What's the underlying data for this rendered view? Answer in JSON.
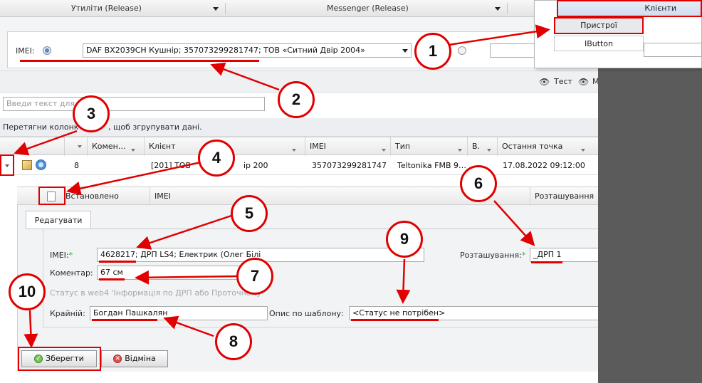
{
  "tabs": {
    "utilities": "Утиліти (Release)",
    "messenger": "Messenger (Release)"
  },
  "menu": {
    "clients": "Клієнти",
    "devices": "Пристрої",
    "ibutton": "IButton"
  },
  "imei_filter": {
    "label": "IMEI:",
    "value": "DAF BX2039CH Кушнір; 357073299281747; ТОВ «Ситний Двір 2004»"
  },
  "toolbar": {
    "test": "Тест",
    "m": "М"
  },
  "search": {
    "placeholder": "Введи текст для"
  },
  "group_hint": {
    "left": "Перетягни колонк",
    "right": ", щоб згрупувати дані."
  },
  "grid": {
    "columns": [
      "Комен…",
      "Клієнт",
      "IMEI",
      "Тип",
      "В.",
      "Остання точка"
    ],
    "row": {
      "num": "8",
      "client_left": "[201] ТОВ",
      "client_right": "ір 200",
      "imei": "357073299281747",
      "type": "Teltonika FMB 9…",
      "last_point": "17.08.2022 09:12:00"
    }
  },
  "subgrid": {
    "installed": "Встановлено",
    "imei": "IMEI",
    "location": "Розташування"
  },
  "form": {
    "tab": "Редагувати",
    "imei_label": "IMEI:",
    "imei_value": "4628217; ДРП LS4; Електрик (Олег Білі",
    "required_mark": "*",
    "location_label": "Розташування:",
    "location_value": "_ДРП 1",
    "comment_label": "Коментар:",
    "comment_value": "67 см",
    "status_hint": "Статус в web4 'Інформація по ДРП або Проточному",
    "last_label": "Крайній:",
    "last_value": "Богдан Пашкалян",
    "template_label": "Опис по шаблону:",
    "template_value": "<Статус не потрібен>",
    "save": "Зберегти",
    "cancel": "Відміна"
  },
  "badges": [
    "1",
    "2",
    "3",
    "4",
    "5",
    "6",
    "7",
    "8",
    "9",
    "10"
  ],
  "colors": {
    "annotation": "#e00000",
    "accent": "#5b86c5"
  }
}
